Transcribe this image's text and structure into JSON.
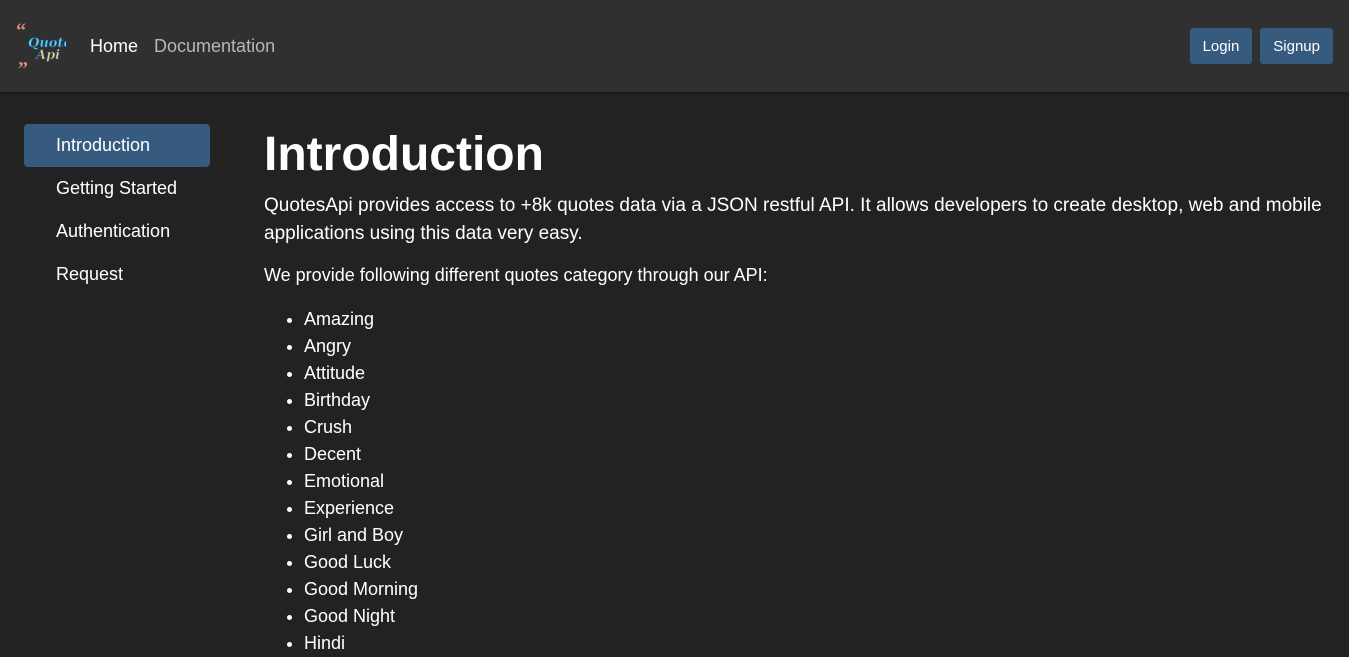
{
  "navbar": {
    "links": {
      "home": "Home",
      "documentation": "Documentation"
    },
    "buttons": {
      "login": "Login",
      "signup": "Signup"
    },
    "logo_icon": "quotes-logo-icon",
    "colors": {
      "background": "#303030",
      "button": "#375a7f"
    }
  },
  "sidebar": {
    "items": [
      {
        "label": "Introduction",
        "active": true
      },
      {
        "label": "Getting Started",
        "active": false
      },
      {
        "label": "Authentication",
        "active": false
      },
      {
        "label": "Request",
        "active": false
      }
    ]
  },
  "main": {
    "title": "Introduction",
    "lead": "QuotesApi provides access to +8k quotes data via a JSON restful API. It allows developers to create desktop, web and mobile applications using this data very easy.",
    "subtext": "We provide following different quotes category through our API:",
    "categories": [
      "Amazing",
      "Angry",
      "Attitude",
      "Birthday",
      "Crush",
      "Decent",
      "Emotional",
      "Experience",
      "Girl and Boy",
      "Good Luck",
      "Good Morning",
      "Good Night",
      "Hindi"
    ]
  },
  "page_colors": {
    "background": "#222222",
    "text": "#ffffff",
    "accent": "#375a7f"
  }
}
